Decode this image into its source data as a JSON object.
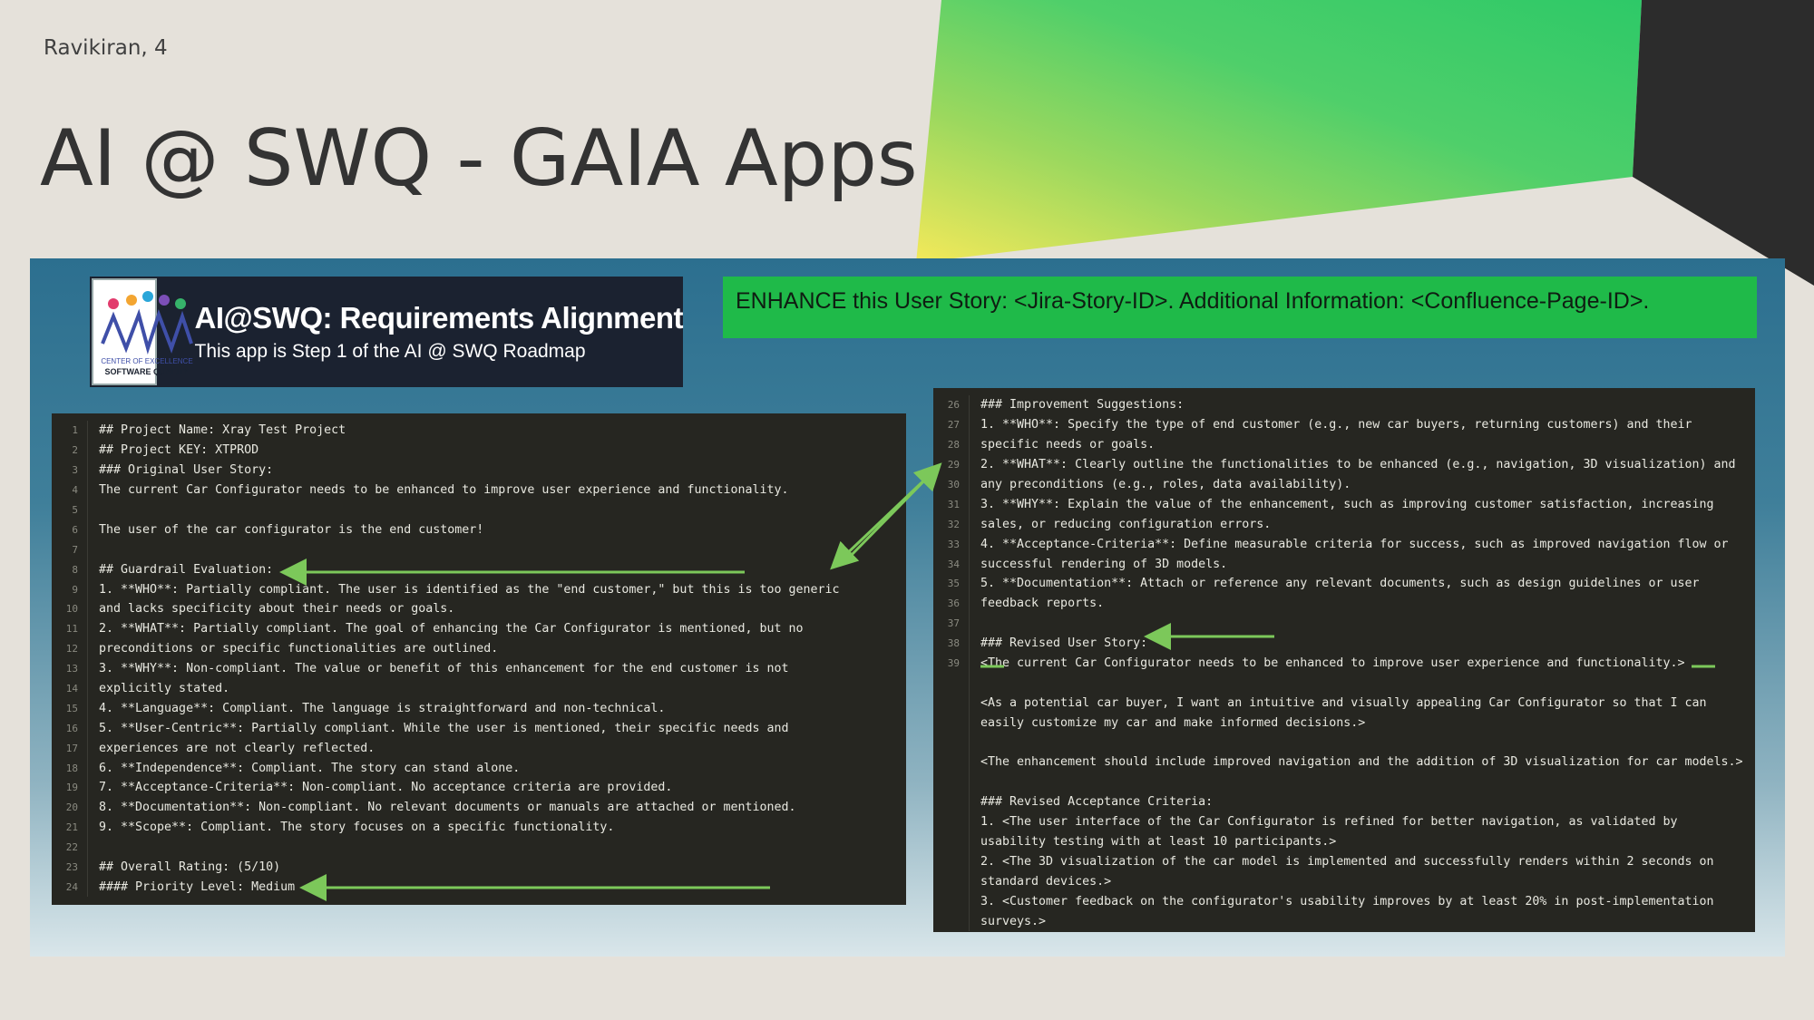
{
  "slide": {
    "author": "Ravikiran, 4",
    "title": "AI @ SWQ - GAIA Apps"
  },
  "colors": {
    "background": "#e5e1da",
    "accent_green": "#1fba49",
    "header_bg": "#1b2230",
    "code_bg": "#262621",
    "arrow_green": "#7cc85a"
  },
  "app": {
    "logo_text_line1": "CENTER OF EXCELLENCE",
    "logo_text_line2": "SOFTWARE QUALITY",
    "title": "AI@SWQ: Requirements Alignment",
    "subtitle": "This app is Step 1 of the AI @ SWQ Roadmap",
    "prompt": "ENHANCE this User Story: <Jira-Story-ID>. Additional Information: <Confluence-Page-ID>."
  },
  "left_code": [
    {
      "n": "1",
      "t": "## Project Name: Xray Test Project"
    },
    {
      "n": "2",
      "t": "## Project KEY: XTPROD"
    },
    {
      "n": "3",
      "t": "### Original User Story:"
    },
    {
      "n": "4",
      "t": "The current Car Configurator needs to be enhanced to improve user experience and functionality."
    },
    {
      "n": "5",
      "t": ""
    },
    {
      "n": "6",
      "t": "The user of the car configurator is the end customer!"
    },
    {
      "n": "7",
      "t": ""
    },
    {
      "n": "8",
      "t": "## Guardrail Evaluation:"
    },
    {
      "n": "9",
      "t": "1. **WHO**: Partially compliant. The user is identified as the \"end customer,\" but this is too generic"
    },
    {
      "n": "10",
      "t": "and lacks specificity about their needs or goals."
    },
    {
      "n": "11",
      "t": "2. **WHAT**: Partially compliant. The goal of enhancing the Car Configurator is mentioned, but no"
    },
    {
      "n": "12",
      "t": "preconditions or specific functionalities are outlined."
    },
    {
      "n": "13",
      "t": "3. **WHY**: Non-compliant. The value or benefit of this enhancement for the end customer is not"
    },
    {
      "n": "14",
      "t": "explicitly stated."
    },
    {
      "n": "15",
      "t": "4. **Language**: Compliant. The language is straightforward and non-technical."
    },
    {
      "n": "16",
      "t": "5. **User-Centric**: Partially compliant. While the user is mentioned, their specific needs and"
    },
    {
      "n": "17",
      "t": "experiences are not clearly reflected."
    },
    {
      "n": "18",
      "t": "6. **Independence**: Compliant. The story can stand alone."
    },
    {
      "n": "19",
      "t": "7. **Acceptance-Criteria**: Non-compliant. No acceptance criteria are provided."
    },
    {
      "n": "20",
      "t": "8. **Documentation**: Non-compliant. No relevant documents or manuals are attached or mentioned."
    },
    {
      "n": "21",
      "t": "9. **Scope**: Compliant. The story focuses on a specific functionality."
    },
    {
      "n": "22",
      "t": ""
    },
    {
      "n": "23",
      "t": "## Overall Rating: (5/10)"
    },
    {
      "n": "24",
      "t": "#### Priority Level: Medium"
    }
  ],
  "right_code": [
    {
      "n": "26",
      "t": "### Improvement Suggestions:"
    },
    {
      "n": "27",
      "t": "1. **WHO**: Specify the type of end customer (e.g., new car buyers, returning customers) and their"
    },
    {
      "n": "28",
      "t": "specific needs or goals."
    },
    {
      "n": "29",
      "t": "2. **WHAT**: Clearly outline the functionalities to be enhanced (e.g., navigation, 3D visualization) and"
    },
    {
      "n": "30",
      "t": "any preconditions (e.g., roles, data availability)."
    },
    {
      "n": "31",
      "t": "3. **WHY**: Explain the value of the enhancement, such as improving customer satisfaction, increasing"
    },
    {
      "n": "32",
      "t": "sales, or reducing configuration errors."
    },
    {
      "n": "33",
      "t": "4. **Acceptance-Criteria**: Define measurable criteria for success, such as improved navigation flow or"
    },
    {
      "n": "34",
      "t": "successful rendering of 3D models."
    },
    {
      "n": "35",
      "t": "5. **Documentation**: Attach or reference any relevant documents, such as design guidelines or user"
    },
    {
      "n": "36",
      "t": "feedback reports."
    },
    {
      "n": "37",
      "t": ""
    },
    {
      "n": "38",
      "t": "### Revised User Story:"
    },
    {
      "n": "39",
      "t": "<The current Car Configurator needs to be enhanced to improve user experience and functionality.>"
    },
    {
      "n": "",
      "t": ""
    },
    {
      "n": "",
      "t": "<As a potential car buyer, I want an intuitive and visually appealing Car Configurator so that I can"
    },
    {
      "n": "",
      "t": "easily customize my car and make informed decisions.>"
    },
    {
      "n": "",
      "t": ""
    },
    {
      "n": "",
      "t": "<The enhancement should include improved navigation and the addition of 3D visualization for car models.>"
    },
    {
      "n": "",
      "t": ""
    },
    {
      "n": "",
      "t": "### Revised Acceptance Criteria:"
    },
    {
      "n": "",
      "t": "1. <The user interface of the Car Configurator is refined for better navigation, as validated by"
    },
    {
      "n": "",
      "t": "usability testing with at least 10 participants.>"
    },
    {
      "n": "",
      "t": "2. <The 3D visualization of the car model is implemented and successfully renders within 2 seconds on"
    },
    {
      "n": "",
      "t": "standard devices.>"
    },
    {
      "n": "",
      "t": "3. <Customer feedback on the configurator's usability improves by at least 20% in post-implementation"
    },
    {
      "n": "",
      "t": "surveys.>"
    }
  ]
}
